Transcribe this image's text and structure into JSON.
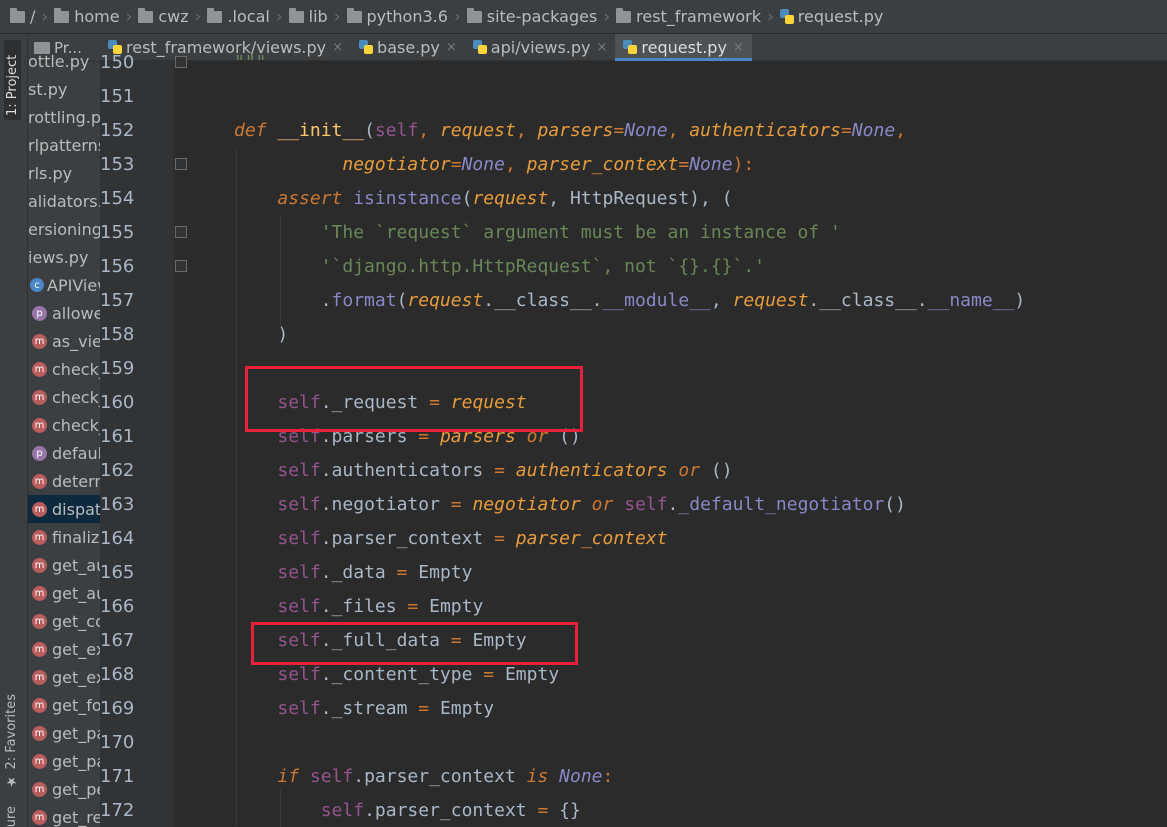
{
  "breadcrumb": {
    "items": [
      {
        "label": "/",
        "icon": "folder-icon"
      },
      {
        "label": "home",
        "icon": "folder-icon"
      },
      {
        "label": "cwz",
        "icon": "folder-icon"
      },
      {
        "label": ".local",
        "icon": "folder-icon"
      },
      {
        "label": "lib",
        "icon": "folder-icon"
      },
      {
        "label": "python3.6",
        "icon": "folder-icon"
      },
      {
        "label": "site-packages",
        "icon": "folder-icon"
      },
      {
        "label": "rest_framework",
        "icon": "folder-icon"
      },
      {
        "label": "request.py",
        "icon": "python-file-icon"
      }
    ]
  },
  "tool_stripe": {
    "project_tab": "1: Project",
    "favorites_tab": "★ 2: Favorites",
    "structure_tab": "ure"
  },
  "project_panel": {
    "header": "Pr...",
    "items": [
      {
        "label": "ottle.py",
        "badge": ""
      },
      {
        "label": "st.py",
        "badge": ""
      },
      {
        "label": "rottling.p",
        "badge": ""
      },
      {
        "label": "rlpatterns.",
        "badge": ""
      },
      {
        "label": "rls.py",
        "badge": ""
      },
      {
        "label": "alidators.p",
        "badge": ""
      },
      {
        "label": "ersioning.p",
        "badge": ""
      },
      {
        "label": "iews.py",
        "badge": ""
      },
      {
        "label": "APIView(V",
        "badge": "c"
      },
      {
        "label": "allowe",
        "badge": "p"
      },
      {
        "label": "as_view",
        "badge": "m"
      },
      {
        "label": "check_",
        "badge": "m"
      },
      {
        "label": "check_",
        "badge": "m"
      },
      {
        "label": "check_",
        "badge": "m"
      },
      {
        "label": "default",
        "badge": "p"
      },
      {
        "label": "determ",
        "badge": "m"
      },
      {
        "label": "dispatc",
        "badge": "m",
        "selected": true
      },
      {
        "label": "finalize",
        "badge": "m"
      },
      {
        "label": "get_au",
        "badge": "m"
      },
      {
        "label": "get_au",
        "badge": "m"
      },
      {
        "label": "get_co",
        "badge": "m"
      },
      {
        "label": "get_ex",
        "badge": "m"
      },
      {
        "label": "get_ex",
        "badge": "m"
      },
      {
        "label": "get_fo",
        "badge": "m"
      },
      {
        "label": "get_pa",
        "badge": "m"
      },
      {
        "label": "get_pa",
        "badge": "m"
      },
      {
        "label": "get_pe",
        "badge": "m"
      },
      {
        "label": "get_re",
        "badge": "m"
      }
    ]
  },
  "tabs": [
    {
      "label": "rest_framework/views.py",
      "active": false
    },
    {
      "label": "base.py",
      "active": false
    },
    {
      "label": "api/views.py",
      "active": false
    },
    {
      "label": "request.py",
      "active": true
    }
  ],
  "close_glyph": "×",
  "lines": [
    {
      "num": "150",
      "tokens": [
        {
          "t": "\"\"\"",
          "c": "str"
        }
      ]
    },
    {
      "num": "151",
      "tokens": []
    },
    {
      "num": "152",
      "tokens": [
        {
          "t": "def ",
          "c": "kwi"
        },
        {
          "t": "__init__",
          "c": "fn"
        },
        {
          "t": "(",
          "c": "plain"
        },
        {
          "t": "self",
          "c": "self"
        },
        {
          "t": ", ",
          "c": "op"
        },
        {
          "t": "request",
          "c": "paramy"
        },
        {
          "t": ", ",
          "c": "op"
        },
        {
          "t": "parsers",
          "c": "paramy"
        },
        {
          "t": "=",
          "c": "op"
        },
        {
          "t": "None",
          "c": "none"
        },
        {
          "t": ", ",
          "c": "op"
        },
        {
          "t": "authenticators",
          "c": "paramy"
        },
        {
          "t": "=",
          "c": "op"
        },
        {
          "t": "None",
          "c": "none"
        },
        {
          "t": ",",
          "c": "op"
        }
      ]
    },
    {
      "num": "153",
      "tokens": [
        {
          "t": "          ",
          "c": "plain"
        },
        {
          "t": "negotiator",
          "c": "paramy"
        },
        {
          "t": "=",
          "c": "op"
        },
        {
          "t": "None",
          "c": "none"
        },
        {
          "t": ", ",
          "c": "op"
        },
        {
          "t": "parser_context",
          "c": "paramy"
        },
        {
          "t": "=",
          "c": "op"
        },
        {
          "t": "None",
          "c": "none"
        },
        {
          "t": "):",
          "c": "op"
        }
      ]
    },
    {
      "num": "154",
      "tokens": [
        {
          "t": "    ",
          "c": "plain"
        },
        {
          "t": "assert ",
          "c": "kwi"
        },
        {
          "t": "isinstance",
          "c": "builtin"
        },
        {
          "t": "(",
          "c": "plain"
        },
        {
          "t": "request",
          "c": "paramy"
        },
        {
          "t": ", HttpRequest), (",
          "c": "plain"
        }
      ]
    },
    {
      "num": "155",
      "tokens": [
        {
          "t": "        ",
          "c": "plain"
        },
        {
          "t": "'The `request` argument must be an instance of '",
          "c": "str"
        }
      ]
    },
    {
      "num": "156",
      "tokens": [
        {
          "t": "        ",
          "c": "plain"
        },
        {
          "t": "'`django.http.HttpRequest`, not `{}.{}`.'",
          "c": "str"
        }
      ]
    },
    {
      "num": "157",
      "tokens": [
        {
          "t": "        ",
          "c": "plain"
        },
        {
          "t": ".",
          "c": "plain"
        },
        {
          "t": "format",
          "c": "builtin"
        },
        {
          "t": "(",
          "c": "plain"
        },
        {
          "t": "request",
          "c": "paramy"
        },
        {
          "t": ".__class__.",
          "c": "plain"
        },
        {
          "t": "__module__",
          "c": "builtin"
        },
        {
          "t": ", ",
          "c": "plain"
        },
        {
          "t": "request",
          "c": "paramy"
        },
        {
          "t": ".__class__.",
          "c": "plain"
        },
        {
          "t": "__name__",
          "c": "builtin"
        },
        {
          "t": ")",
          "c": "plain"
        }
      ]
    },
    {
      "num": "158",
      "tokens": [
        {
          "t": "    )",
          "c": "plain"
        }
      ]
    },
    {
      "num": "159",
      "tokens": []
    },
    {
      "num": "160",
      "tokens": [
        {
          "t": "    ",
          "c": "plain"
        },
        {
          "t": "self",
          "c": "self"
        },
        {
          "t": "._request ",
          "c": "plain"
        },
        {
          "t": "= ",
          "c": "op"
        },
        {
          "t": "request",
          "c": "paramy"
        }
      ]
    },
    {
      "num": "161",
      "tokens": [
        {
          "t": "    ",
          "c": "plain"
        },
        {
          "t": "self",
          "c": "self"
        },
        {
          "t": ".parsers ",
          "c": "plain"
        },
        {
          "t": "= ",
          "c": "op"
        },
        {
          "t": "parsers ",
          "c": "paramy"
        },
        {
          "t": "or ",
          "c": "kwi"
        },
        {
          "t": "()",
          "c": "plain"
        }
      ]
    },
    {
      "num": "162",
      "tokens": [
        {
          "t": "    ",
          "c": "plain"
        },
        {
          "t": "self",
          "c": "self"
        },
        {
          "t": ".authenticators ",
          "c": "plain"
        },
        {
          "t": "= ",
          "c": "op"
        },
        {
          "t": "authenticators ",
          "c": "paramy"
        },
        {
          "t": "or ",
          "c": "kwi"
        },
        {
          "t": "()",
          "c": "plain"
        }
      ]
    },
    {
      "num": "163",
      "tokens": [
        {
          "t": "    ",
          "c": "plain"
        },
        {
          "t": "self",
          "c": "self"
        },
        {
          "t": ".negotiator ",
          "c": "plain"
        },
        {
          "t": "= ",
          "c": "op"
        },
        {
          "t": "negotiator ",
          "c": "paramy"
        },
        {
          "t": "or ",
          "c": "kwi"
        },
        {
          "t": "self",
          "c": "self"
        },
        {
          "t": ".",
          "c": "plain"
        },
        {
          "t": "_default_negotiator",
          "c": "builtin"
        },
        {
          "t": "()",
          "c": "plain"
        }
      ]
    },
    {
      "num": "164",
      "tokens": [
        {
          "t": "    ",
          "c": "plain"
        },
        {
          "t": "self",
          "c": "self"
        },
        {
          "t": ".parser_context ",
          "c": "plain"
        },
        {
          "t": "= ",
          "c": "op"
        },
        {
          "t": "parser_context",
          "c": "paramy"
        }
      ]
    },
    {
      "num": "165",
      "tokens": [
        {
          "t": "    ",
          "c": "plain"
        },
        {
          "t": "self",
          "c": "self"
        },
        {
          "t": "._data ",
          "c": "plain"
        },
        {
          "t": "= ",
          "c": "op"
        },
        {
          "t": "Empty",
          "c": "plain"
        }
      ]
    },
    {
      "num": "166",
      "tokens": [
        {
          "t": "    ",
          "c": "plain"
        },
        {
          "t": "self",
          "c": "self"
        },
        {
          "t": "._files ",
          "c": "plain"
        },
        {
          "t": "= ",
          "c": "op"
        },
        {
          "t": "Empty",
          "c": "plain"
        }
      ]
    },
    {
      "num": "167",
      "tokens": [
        {
          "t": "    ",
          "c": "plain"
        },
        {
          "t": "self",
          "c": "self"
        },
        {
          "t": "._full_data ",
          "c": "plain"
        },
        {
          "t": "= ",
          "c": "op"
        },
        {
          "t": "Empty",
          "c": "plain"
        }
      ]
    },
    {
      "num": "168",
      "tokens": [
        {
          "t": "    ",
          "c": "plain"
        },
        {
          "t": "self",
          "c": "self"
        },
        {
          "t": "._content_type ",
          "c": "plain"
        },
        {
          "t": "= ",
          "c": "op"
        },
        {
          "t": "Empty",
          "c": "plain"
        }
      ]
    },
    {
      "num": "169",
      "tokens": [
        {
          "t": "    ",
          "c": "plain"
        },
        {
          "t": "self",
          "c": "self"
        },
        {
          "t": "._stream ",
          "c": "plain"
        },
        {
          "t": "= ",
          "c": "op"
        },
        {
          "t": "Empty",
          "c": "plain"
        }
      ]
    },
    {
      "num": "170",
      "tokens": []
    },
    {
      "num": "171",
      "tokens": [
        {
          "t": "    ",
          "c": "plain"
        },
        {
          "t": "if ",
          "c": "kwi"
        },
        {
          "t": "self",
          "c": "self"
        },
        {
          "t": ".parser_context ",
          "c": "plain"
        },
        {
          "t": "is ",
          "c": "kwi"
        },
        {
          "t": "None",
          "c": "none"
        },
        {
          "t": ":",
          "c": "op"
        }
      ]
    },
    {
      "num": "172",
      "tokens": [
        {
          "t": "        ",
          "c": "plain"
        },
        {
          "t": "self",
          "c": "self"
        },
        {
          "t": ".parser_context ",
          "c": "plain"
        },
        {
          "t": "= ",
          "c": "op"
        },
        {
          "t": "{}",
          "c": "plain"
        }
      ]
    }
  ],
  "colors": {
    "highlight": "#e8203c",
    "background": "#2b2b2b",
    "panel": "#3c3f41"
  }
}
